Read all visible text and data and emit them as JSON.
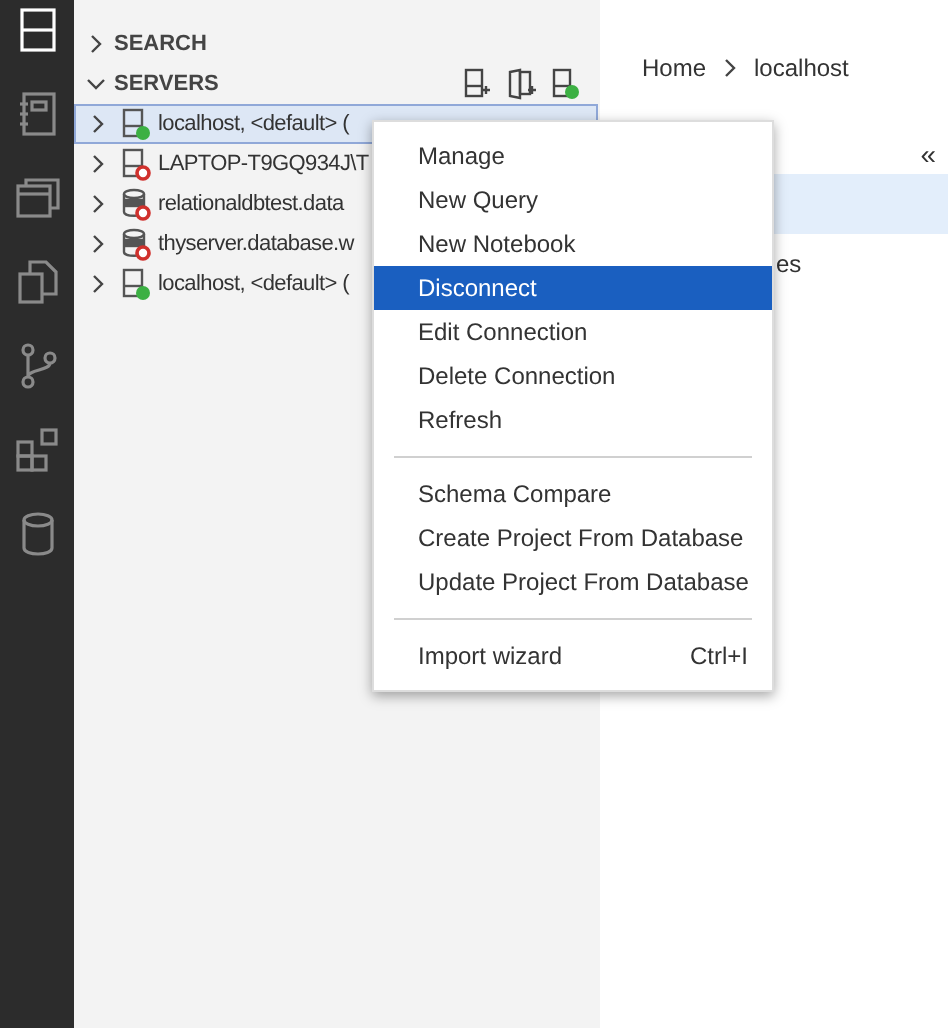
{
  "activity_bar": [
    {
      "kind": "servers",
      "selected": true
    },
    {
      "kind": "notebook",
      "selected": false
    },
    {
      "kind": "windows",
      "selected": false
    },
    {
      "kind": "copy",
      "selected": false
    },
    {
      "kind": "git",
      "selected": false
    },
    {
      "kind": "extensions",
      "selected": false
    },
    {
      "kind": "database",
      "selected": false
    }
  ],
  "sidebar": {
    "sections": [
      {
        "title": "SEARCH",
        "expanded": false
      },
      {
        "title": "SERVERS",
        "expanded": true
      }
    ],
    "servers": [
      {
        "label": "localhost, <default> (",
        "kind": "server",
        "connected": true,
        "selected": true
      },
      {
        "label": "LAPTOP-T9GQ934J\\T",
        "kind": "server",
        "connected": false,
        "selected": false
      },
      {
        "label": "relationaldbtest.data",
        "kind": "sql",
        "connected": false,
        "selected": false
      },
      {
        "label": "thyserver.database.w",
        "kind": "sql",
        "connected": false,
        "selected": false
      },
      {
        "label": "localhost, <default> (",
        "kind": "server",
        "connected": true,
        "selected": false
      }
    ]
  },
  "breadcrumb": [
    "Home",
    "localhost"
  ],
  "panel": {
    "collapse": "«",
    "partial_text": "es"
  },
  "context_menu": {
    "groups": [
      [
        {
          "label": "Manage",
          "selected": false
        },
        {
          "label": "New Query",
          "selected": false
        },
        {
          "label": "New Notebook",
          "selected": false
        },
        {
          "label": "Disconnect",
          "selected": true
        },
        {
          "label": "Edit Connection",
          "selected": false
        },
        {
          "label": "Delete Connection",
          "selected": false
        },
        {
          "label": "Refresh",
          "selected": false
        }
      ],
      [
        {
          "label": "Schema Compare",
          "selected": false
        },
        {
          "label": "Create Project From Database",
          "selected": false
        },
        {
          "label": "Update Project From Database",
          "selected": false
        }
      ],
      [
        {
          "label": "Import wizard",
          "shortcut": "Ctrl+I",
          "selected": false
        }
      ]
    ]
  }
}
